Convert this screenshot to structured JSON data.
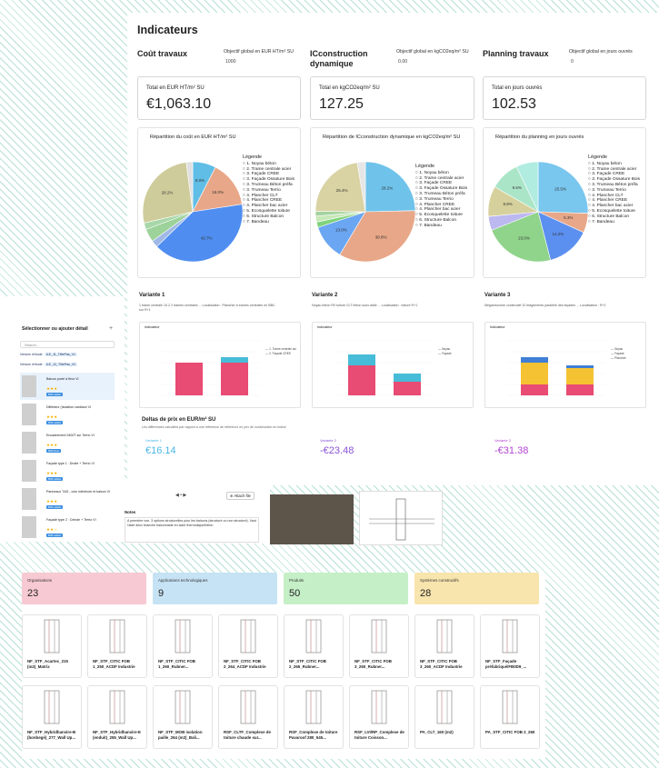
{
  "indicateurs": {
    "title": "Indicateurs",
    "columns": [
      {
        "title": "Coût travaux",
        "objective_label": "Objectif global en EUR HT/m² SU",
        "objective_value": "1000",
        "kpi_label": "Total en EUR HT/m² SU",
        "kpi_value": "€1,063.10",
        "pie_title": "Répartition du coût en EUR HT/m² SU"
      },
      {
        "title": "ICconstruction dynamique",
        "objective_label": "Objectif global en kgCO2eq/m² SU",
        "objective_value": "0.00",
        "kpi_label": "Total en kgCO2eq/m² SU",
        "kpi_value": "127.25",
        "pie_title": "Répartition de ICconstruction dynamique en kgCO2eq/m² SU"
      },
      {
        "title": "Planning travaux",
        "objective_label": "Objectif global en jours ouvrés",
        "objective_value": "0",
        "kpi_label": "Total en jours ouvrés",
        "kpi_value": "102.53",
        "pie_title": "Répartition du planning en jours ouvrés"
      }
    ],
    "legend_title": "Légende",
    "legend": [
      "1. Noyau béton",
      "2. Trame centrale acier",
      "3. Façade CREE",
      "3. Façade Ossature Bois",
      "3. Trumeau Béton préfa",
      "3. Trumeau Terrio",
      "4. Plancher CLT",
      "4. Plancher CREE",
      "4. Plancher bac acier",
      "5. Ecosquelette toiture",
      "6. Structure Balcon",
      "7. Bandeau"
    ],
    "legend_b": [
      "1. Noyau béton",
      "2. Trame centrale acier",
      "3. Façade CREE",
      "3. Façade Ossature Bois",
      "3. Trumeau Béton préfa",
      "3. Trumeau Terrio",
      "4. Plancher CREE",
      "4. Plancher bac acier",
      "5. Ecosquelette toiture",
      "6. Structure Balcon",
      "7. Bandeau"
    ]
  },
  "chart_data": [
    {
      "type": "pie",
      "title": "Répartition du coût en EUR HT/m² SU",
      "values": [
        8.0,
        16.0,
        42.7,
        2.4,
        4.5,
        2.3,
        28.2,
        2.2
      ],
      "labels": [
        "8.0%",
        "16.0%",
        "42.7%",
        "",
        "",
        "",
        "28.2%",
        ""
      ],
      "colors": [
        "#5fbde6",
        "#e8a788",
        "#4f8ef0",
        "#9fb8e6",
        "#9dd29a",
        "#a7d7a8",
        "#cfcc9c",
        "#e0e0e0"
      ]
    },
    {
      "type": "pie",
      "title": "Répartition de ICconstruction dynamique en kgCO2eq/m² SU",
      "values": [
        28.2,
        38.8,
        13.0,
        2.0,
        2.2,
        1.8,
        25.4,
        3.0
      ],
      "labels": [
        "28.2%",
        "38.8%",
        "13.0%",
        "",
        "",
        "",
        "25.4%",
        ""
      ],
      "colors": [
        "#6fc3ea",
        "#e8a788",
        "#6aa6f2",
        "#7fd37b",
        "#c8e8b8",
        "#a3d39f",
        "#d9d2a3",
        "#e6e6e6"
      ]
    },
    {
      "type": "pie",
      "title": "Répartition du planning en jours ouvrés",
      "values": [
        25.5,
        6.3,
        14.2,
        23.0,
        4.5,
        9.8,
        9.6,
        7.1
      ],
      "labels": [
        "25.5%",
        "6.3%",
        "14.2%",
        "23.0%",
        "",
        "9.8%",
        "9.6%",
        ""
      ],
      "colors": [
        "#79c6ee",
        "#e8a788",
        "#5b90f0",
        "#8fd48a",
        "#bcb8f0",
        "#d6d19c",
        "#abe5c8",
        "#b0ece0"
      ]
    },
    {
      "type": "bar",
      "title": "Variante 1",
      "categories": [
        "A",
        "B"
      ],
      "series": [
        {
          "name": "1. Trame centrale acier",
          "values": [
            60,
            60
          ]
        },
        {
          "name": "2. Façade CREE",
          "values": [
            0,
            10
          ]
        }
      ],
      "ylim": [
        0,
        100
      ]
    },
    {
      "type": "bar",
      "title": "Variante 2",
      "categories": [
        "A",
        "B"
      ],
      "series": [
        {
          "name": "Noyau",
          "values": [
            55,
            25
          ]
        },
        {
          "name": "Façade",
          "values": [
            20,
            15
          ]
        }
      ],
      "ylim": [
        0,
        100
      ]
    },
    {
      "type": "bar",
      "title": "Variante 3",
      "categories": [
        "A",
        "B"
      ],
      "series": [
        {
          "name": "Noyau",
          "values": [
            20,
            20
          ]
        },
        {
          "name": "Façade",
          "values": [
            40,
            30
          ]
        },
        {
          "name": "Plancher",
          "values": [
            10,
            5
          ]
        }
      ],
      "ylim": [
        0,
        100
      ]
    }
  ],
  "variantes": {
    "titles": [
      "Variante 1",
      "Variante 2",
      "Variante 3"
    ],
    "descs": [
      "1 trame centrale 10.2 2 trames centrales ...\nLocalisation : Plancher à trames centrales en BBC sur R+1",
      "Noyau béton R0 toiture CLT béton sous dalle ...\nLocalisation : toiture R+1",
      "Mégastructure constructif 10 étagements parallèle des façades ...\nLocalisation : R+1"
    ],
    "bar_title": "Indicateur",
    "deltas_title": "Deltas de prix en EUR/m² SU",
    "deltas_sub": "Les différences calculées par rapport à une référence de référence en prix de construction en indice",
    "delta_labels": [
      "Variante 1",
      "Variante 2",
      "Variante 3"
    ],
    "delta_values": [
      "€16.14",
      "-€23.48",
      "-€31.38"
    ]
  },
  "left": {
    "title": "Sélectionner ou ajouter détail",
    "search": "Search...",
    "versions": [
      {
        "label": "Version d'étude",
        "tag": "ILE_11_TiltePas_V1"
      },
      {
        "label": "Version d'étude",
        "tag": "ILE_12_TiltePas_V2"
      }
    ],
    "items": [
      {
        "name": "Balcon porté à fleur VI",
        "stars": "★★★",
        "tag": "BIM validé"
      },
      {
        "name": "Diffédeur (Isolation cardiaux VI",
        "stars": "★★★",
        "tag": "BIM validé"
      },
      {
        "name": "Encadrement 0400T sur Terrio VI",
        "stars": "★★★",
        "tag": "BIM final"
      },
      {
        "name": "Façade type 1 : Droite + Terrio VI",
        "stars": "★★★",
        "tag": "BIM validé"
      },
      {
        "name": "Panneaux T&D - coin intérieure et balcon VI",
        "stars": "★★★",
        "tag": "BIM validé"
      },
      {
        "name": "Façade type 2 : Ceinde + Terrio VI",
        "stars": "★★☆",
        "tag": "BIM validé"
      }
    ]
  },
  "mid": {
    "pager": "◀   •   ▶",
    "attach": "⊕ Attach file",
    "notes_title": "Notes",
    "notes_text": "A première vue, 3 options structurelles pour les balcons (structuré ou non structuré). Vaut l'aidé deux branche balconnade en acier thermotique/béton"
  },
  "bottom": {
    "stats": [
      {
        "label": "Organisations",
        "value": "23",
        "color": "#f7c9d2"
      },
      {
        "label": "Applications technologiques",
        "value": "9",
        "color": "#c6e3f5"
      },
      {
        "label": "Produits",
        "value": "50",
        "color": "#c5efc7"
      },
      {
        "label": "Systèmes constructifs",
        "value": "28",
        "color": "#f8e4ad"
      }
    ],
    "tiles": [
      "NF_STF_Acartec_215 (m2)_Matrix",
      "NF_STF_CITIC FOB 1_250_ACDF Industrie",
      "NF_STF_CITIC FOB 1_260_Rubner...",
      "NF_STF_CITIC FOB 2_264_ACDF Industrie",
      "NF_STF_CITIC FOB 2_265_Rubner...",
      "NF_STF_CITIC FOB 3_260_Rubner...",
      "NF_STF_CITIC FOB 3_260_ACDF Industrie",
      "NF_STF_Façade préfabriqué/FB0D9_...",
      "NF_STF_Hybridhanvire-B (bonbegé)_277_Wall Up...",
      "NF_STF_Hybridhanvire-E (enduit)_255_Wall Up...",
      "NF_STF_MOB isolation paille_264 (m2)_Bali...",
      "RSF_CLTF_Complexe de toiture chaude sur...",
      "RSF_Complexe de toiture Pavaroof 280_545...",
      "RSF_LVI/RP_Complexe de toiture Coisson...",
      "PA_CLT_160 (m2)",
      "PA_STF_CITIC FOB 2_260"
    ]
  }
}
